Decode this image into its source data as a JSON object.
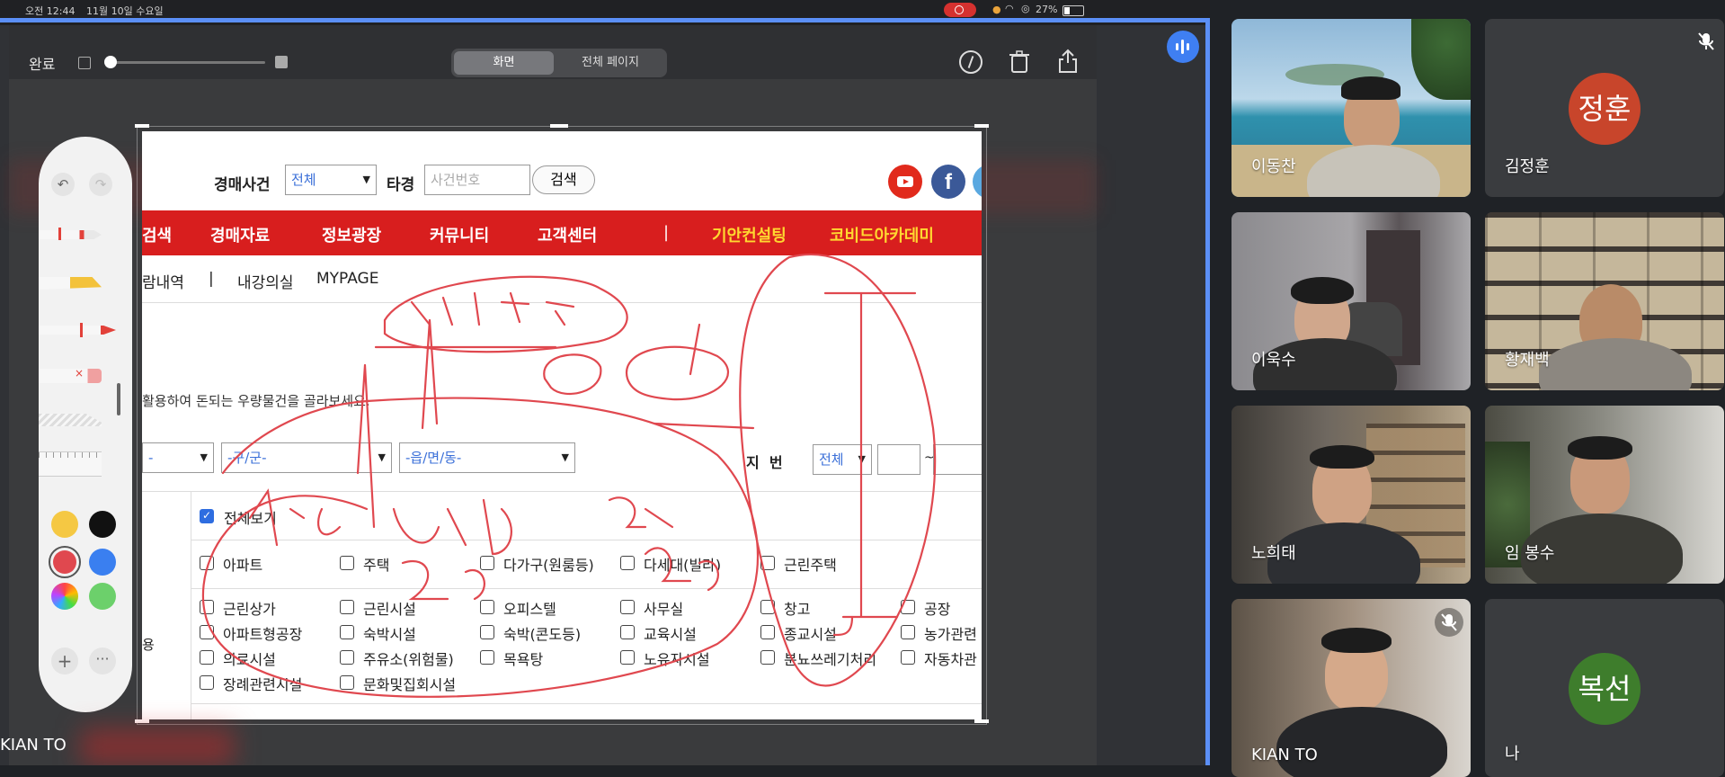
{
  "status_bar": {
    "time": "오전 12:44",
    "date": "11월 10일 수요일",
    "battery": "27%"
  },
  "toolbar": {
    "done_label": "완료",
    "seg_screen": "화면",
    "seg_full": "전체 페이지"
  },
  "site": {
    "search_label": "경매사건",
    "search_select": "전체",
    "search_prefix": "타경",
    "search_placeholder": "사건번호",
    "search_button": "검색",
    "nav": [
      "검색",
      "경매자료",
      "정보광장",
      "커뮤니티",
      "고객센터",
      "|",
      "기안컨설팅",
      "코비드아카데미"
    ],
    "subnav": [
      "람내역",
      "|",
      "내강의실",
      "MYPAGE"
    ],
    "intro_text": "활용하여 돈되는 우량물건을 골라보세요.",
    "filters": {
      "district": "-구/군-",
      "town": "-읍/면/동-",
      "jibun_label": "지  번",
      "jibun_select": "전체",
      "tilde": "~"
    },
    "view_all": "전체보기",
    "row1": [
      "아파트",
      "주택",
      "다가구(원룸등)",
      "다세대(빌라)",
      "근린주택"
    ],
    "row2": [
      "근린상가",
      "근린시설",
      "오피스텔",
      "사무실",
      "창고",
      "공장"
    ],
    "row3": [
      "아파트형공장",
      "숙박시설",
      "숙박(콘도등)",
      "교육시설",
      "종교시설",
      "농가관련"
    ],
    "row4": [
      "의료시설",
      "주유소(위험물)",
      "목욕탕",
      "노유자시설",
      "분뇨쓰레기처리",
      "자동차관"
    ],
    "row5": [
      "장례관련시설",
      "문화및집회시설"
    ],
    "side_label": "용"
  },
  "presenter_name": "KIAN TO",
  "participants": [
    {
      "name": "이동찬",
      "type": "video"
    },
    {
      "name": "김정훈",
      "type": "avatar",
      "initials": "정훈",
      "color": "#c8452b",
      "muted": true
    },
    {
      "name": "이욱수",
      "type": "video"
    },
    {
      "name": "황재백",
      "type": "video"
    },
    {
      "name": "노희태",
      "type": "video"
    },
    {
      "name": "임 봉수",
      "type": "video"
    },
    {
      "name": "KIAN TO",
      "type": "video",
      "muted": true
    },
    {
      "name": "나",
      "type": "avatar",
      "initials": "복선",
      "color": "#3e7d2c"
    }
  ],
  "colors": {
    "accent_blue": "#5b8ff7",
    "site_red": "#d81e1e",
    "annotation_red": "#e0484f"
  }
}
